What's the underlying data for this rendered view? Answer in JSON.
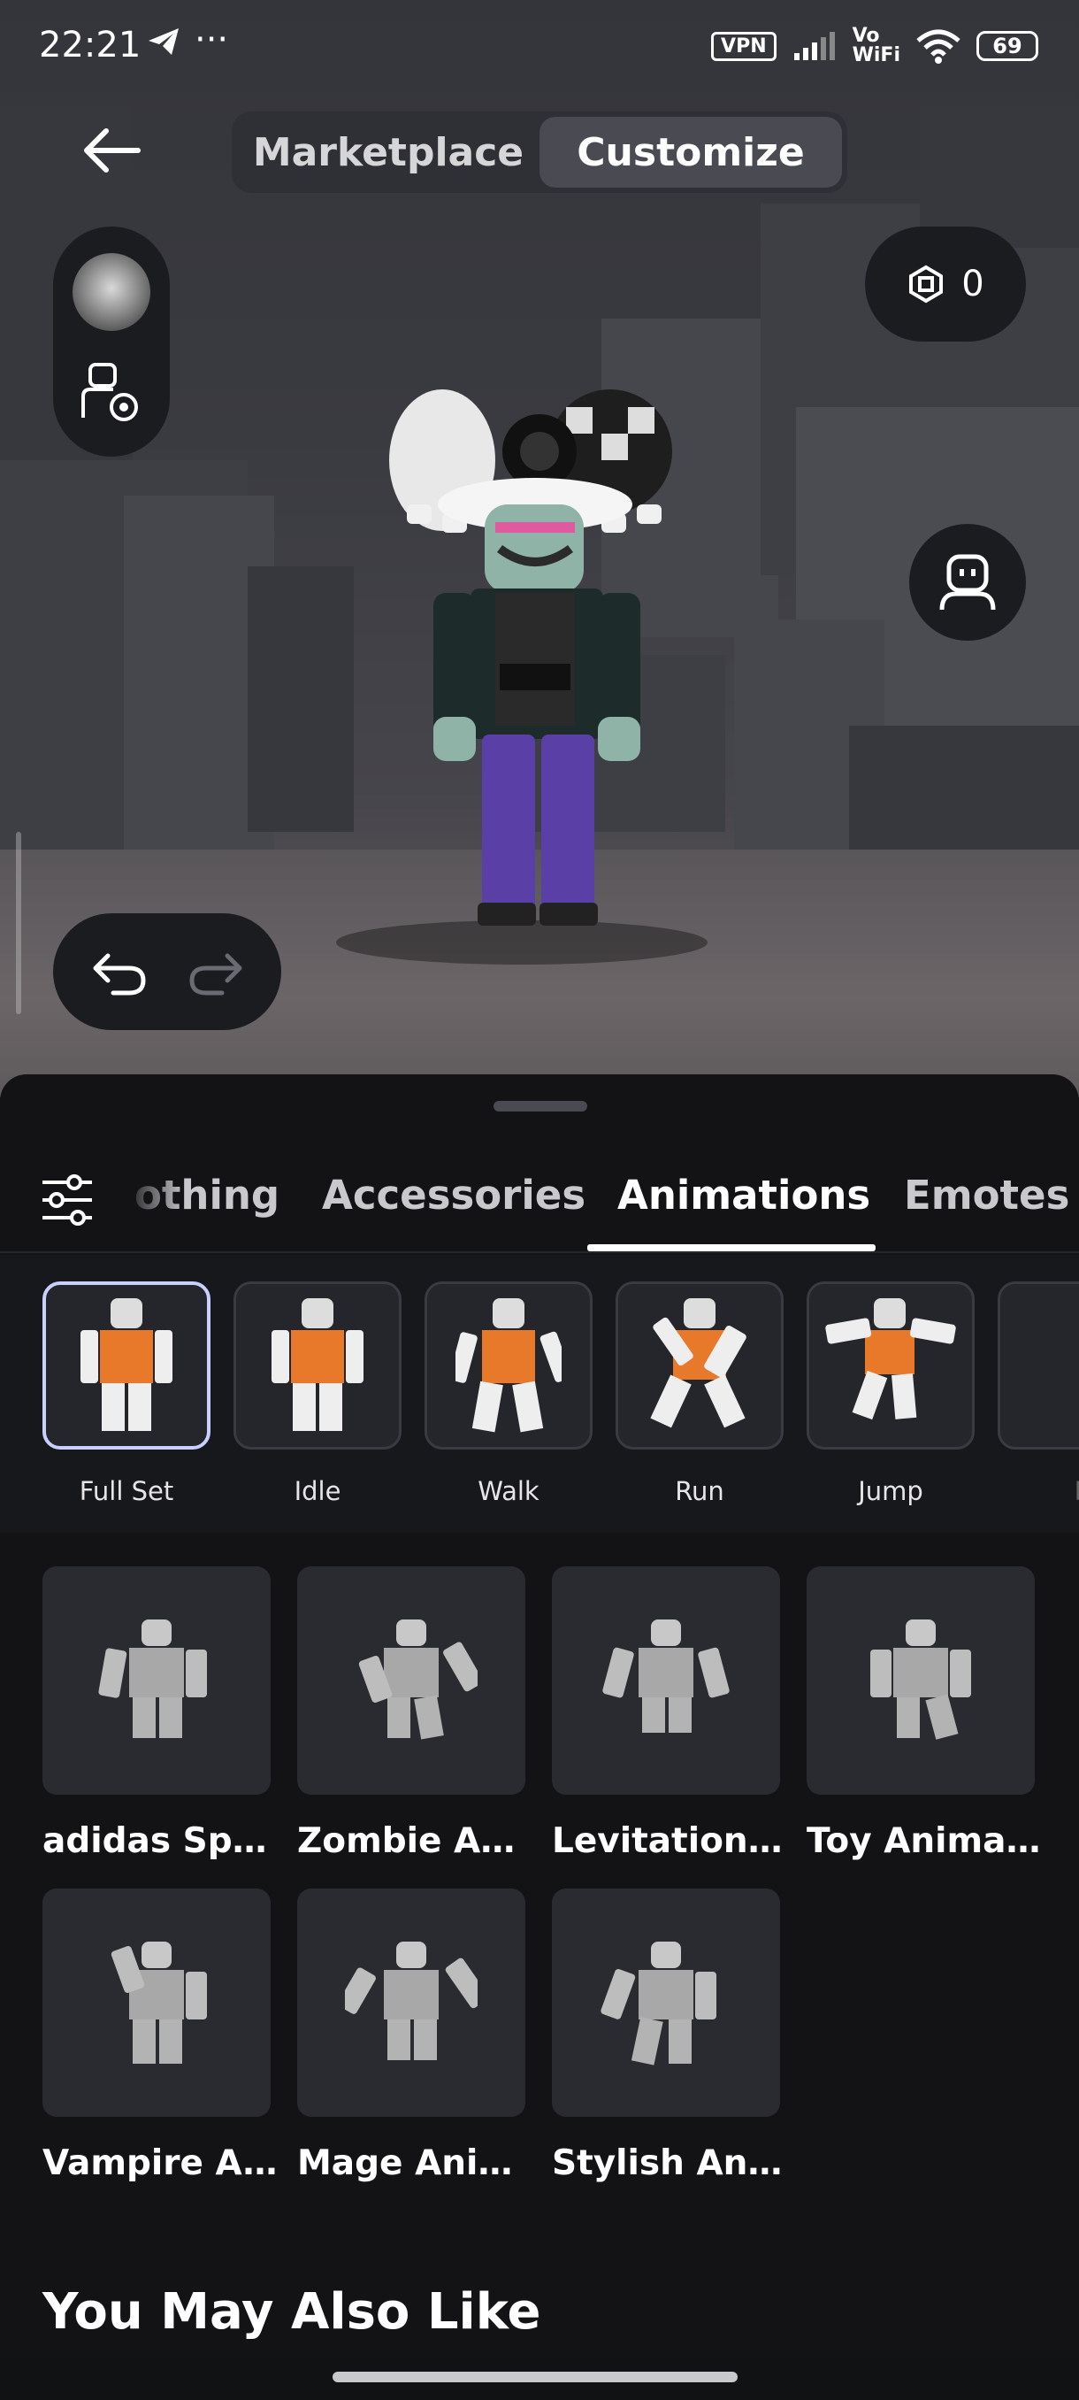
{
  "status_bar": {
    "time": "22:21",
    "extra": "···",
    "vpn": "VPN",
    "vowifi": "Vo\nWiFi",
    "battery": "69"
  },
  "top_nav": {
    "tabs": [
      {
        "label": "Marketplace",
        "active": false
      },
      {
        "label": "Customize",
        "active": true
      }
    ]
  },
  "robux": {
    "icon": "robux-icon",
    "value": "0"
  },
  "category_tabs": [
    {
      "label": "othing",
      "active": false
    },
    {
      "label": "Accessories",
      "active": false
    },
    {
      "label": "Animations",
      "active": true
    },
    {
      "label": "Emotes",
      "active": false
    }
  ],
  "sub_categories": [
    {
      "label": "Full Set",
      "selected": true
    },
    {
      "label": "Idle",
      "selected": false
    },
    {
      "label": "Walk",
      "selected": false
    },
    {
      "label": "Run",
      "selected": false
    },
    {
      "label": "Jump",
      "selected": false
    },
    {
      "label": "F",
      "selected": false
    }
  ],
  "items": [
    {
      "title": "adidas Spo..."
    },
    {
      "title": "Zombie Ani..."
    },
    {
      "title": "Levitation ..."
    },
    {
      "title": "Toy Animat..."
    },
    {
      "title": "Vampire A..."
    },
    {
      "title": "Mage Anim..."
    },
    {
      "title": "Stylish Ani..."
    }
  ],
  "section": {
    "title": "You May Also Like"
  },
  "colors": {
    "accent_selected": "#c9d0ff",
    "sheet_bg": "#131316",
    "card_bg": "#2a2b30"
  }
}
